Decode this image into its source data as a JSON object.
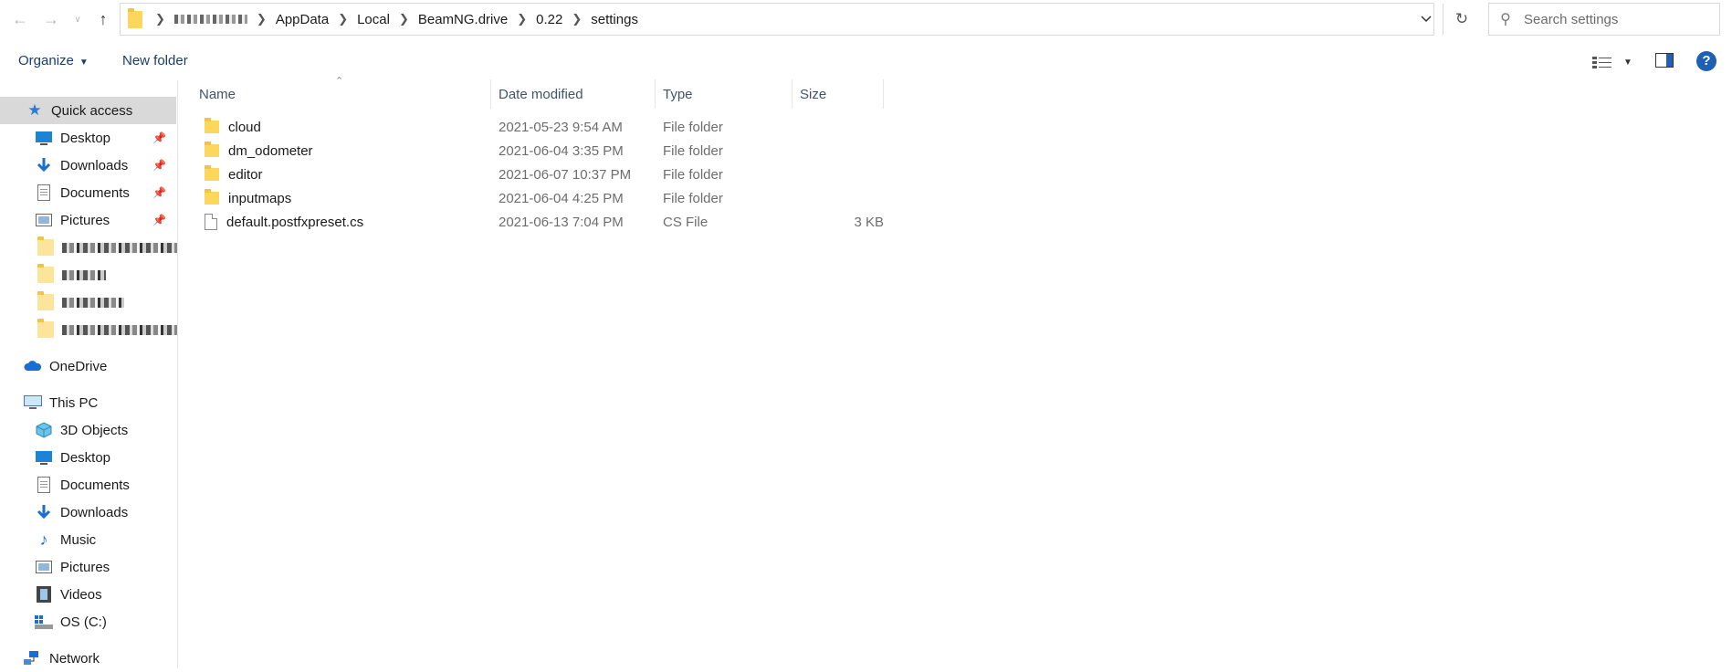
{
  "window": {
    "search_placeholder": "Search settings"
  },
  "address": {
    "crumbs": [
      "AppData",
      "Local",
      "BeamNG.drive",
      "0.22",
      "settings"
    ]
  },
  "toolbar": {
    "organize": "Organize",
    "new_folder": "New folder"
  },
  "columns": {
    "name": "Name",
    "date": "Date modified",
    "type": "Type",
    "size": "Size"
  },
  "files": [
    {
      "name": "cloud",
      "date": "2021-05-23 9:54 AM",
      "type": "File folder",
      "size": "",
      "icon": "folder-icon"
    },
    {
      "name": "dm_odometer",
      "date": "2021-06-04 3:35 PM",
      "type": "File folder",
      "size": "",
      "icon": "folder-icon"
    },
    {
      "name": "editor",
      "date": "2021-06-07 10:37 PM",
      "type": "File folder",
      "size": "",
      "icon": "folder-icon"
    },
    {
      "name": "inputmaps",
      "date": "2021-06-04 4:25 PM",
      "type": "File folder",
      "size": "",
      "icon": "folder-icon"
    },
    {
      "name": "default.postfxpreset.cs",
      "date": "2021-06-13 7:04 PM",
      "type": "CS File",
      "size": "3 KB",
      "icon": "file-icon"
    }
  ],
  "sidebar": {
    "quick_access": "Quick access",
    "quick_items": [
      {
        "label": "Desktop",
        "icon": "desktop-icon",
        "pinned": true
      },
      {
        "label": "Downloads",
        "icon": "downloads-icon",
        "pinned": true
      },
      {
        "label": "Documents",
        "icon": "documents-icon",
        "pinned": true
      },
      {
        "label": "Pictures",
        "icon": "pictures-icon",
        "pinned": true
      }
    ],
    "onedrive": "OneDrive",
    "this_pc": "This PC",
    "pc_items": [
      {
        "label": "3D Objects",
        "icon": "3d-objects-icon"
      },
      {
        "label": "Desktop",
        "icon": "desktop-icon"
      },
      {
        "label": "Documents",
        "icon": "documents-icon"
      },
      {
        "label": "Downloads",
        "icon": "downloads-icon"
      },
      {
        "label": "Music",
        "icon": "music-icon"
      },
      {
        "label": "Pictures",
        "icon": "pictures-icon"
      },
      {
        "label": "Videos",
        "icon": "videos-icon"
      },
      {
        "label": "OS (C:)",
        "icon": "drive-icon"
      }
    ],
    "network": "Network"
  },
  "colors": {
    "accent": "#1f5fb4",
    "folder": "#fcd75b",
    "selected_bg": "#d9d9d9"
  }
}
